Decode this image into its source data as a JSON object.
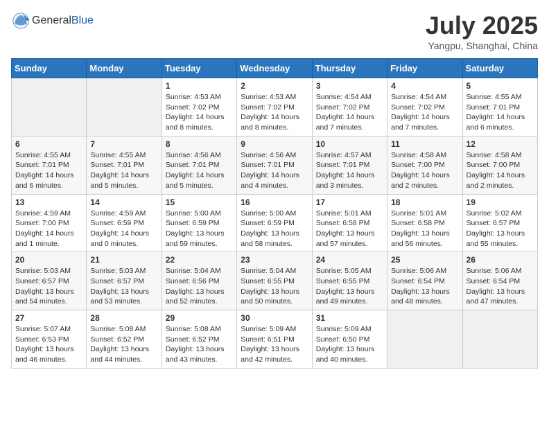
{
  "header": {
    "logo_general": "General",
    "logo_blue": "Blue",
    "month_title": "July 2025",
    "location": "Yangpu, Shanghai, China"
  },
  "weekdays": [
    "Sunday",
    "Monday",
    "Tuesday",
    "Wednesday",
    "Thursday",
    "Friday",
    "Saturday"
  ],
  "weeks": [
    [
      {
        "day": "",
        "info": ""
      },
      {
        "day": "",
        "info": ""
      },
      {
        "day": "1",
        "sunrise": "4:53 AM",
        "sunset": "7:02 PM",
        "daylight": "14 hours and 8 minutes."
      },
      {
        "day": "2",
        "sunrise": "4:53 AM",
        "sunset": "7:02 PM",
        "daylight": "14 hours and 8 minutes."
      },
      {
        "day": "3",
        "sunrise": "4:54 AM",
        "sunset": "7:02 PM",
        "daylight": "14 hours and 7 minutes."
      },
      {
        "day": "4",
        "sunrise": "4:54 AM",
        "sunset": "7:02 PM",
        "daylight": "14 hours and 7 minutes."
      },
      {
        "day": "5",
        "sunrise": "4:55 AM",
        "sunset": "7:01 PM",
        "daylight": "14 hours and 6 minutes."
      }
    ],
    [
      {
        "day": "6",
        "sunrise": "4:55 AM",
        "sunset": "7:01 PM",
        "daylight": "14 hours and 6 minutes."
      },
      {
        "day": "7",
        "sunrise": "4:55 AM",
        "sunset": "7:01 PM",
        "daylight": "14 hours and 5 minutes."
      },
      {
        "day": "8",
        "sunrise": "4:56 AM",
        "sunset": "7:01 PM",
        "daylight": "14 hours and 5 minutes."
      },
      {
        "day": "9",
        "sunrise": "4:56 AM",
        "sunset": "7:01 PM",
        "daylight": "14 hours and 4 minutes."
      },
      {
        "day": "10",
        "sunrise": "4:57 AM",
        "sunset": "7:01 PM",
        "daylight": "14 hours and 3 minutes."
      },
      {
        "day": "11",
        "sunrise": "4:58 AM",
        "sunset": "7:00 PM",
        "daylight": "14 hours and 2 minutes."
      },
      {
        "day": "12",
        "sunrise": "4:58 AM",
        "sunset": "7:00 PM",
        "daylight": "14 hours and 2 minutes."
      }
    ],
    [
      {
        "day": "13",
        "sunrise": "4:59 AM",
        "sunset": "7:00 PM",
        "daylight": "14 hours and 1 minute."
      },
      {
        "day": "14",
        "sunrise": "4:59 AM",
        "sunset": "6:59 PM",
        "daylight": "14 hours and 0 minutes."
      },
      {
        "day": "15",
        "sunrise": "5:00 AM",
        "sunset": "6:59 PM",
        "daylight": "13 hours and 59 minutes."
      },
      {
        "day": "16",
        "sunrise": "5:00 AM",
        "sunset": "6:59 PM",
        "daylight": "13 hours and 58 minutes."
      },
      {
        "day": "17",
        "sunrise": "5:01 AM",
        "sunset": "6:58 PM",
        "daylight": "13 hours and 57 minutes."
      },
      {
        "day": "18",
        "sunrise": "5:01 AM",
        "sunset": "6:58 PM",
        "daylight": "13 hours and 56 minutes."
      },
      {
        "day": "19",
        "sunrise": "5:02 AM",
        "sunset": "6:57 PM",
        "daylight": "13 hours and 55 minutes."
      }
    ],
    [
      {
        "day": "20",
        "sunrise": "5:03 AM",
        "sunset": "6:57 PM",
        "daylight": "13 hours and 54 minutes."
      },
      {
        "day": "21",
        "sunrise": "5:03 AM",
        "sunset": "6:57 PM",
        "daylight": "13 hours and 53 minutes."
      },
      {
        "day": "22",
        "sunrise": "5:04 AM",
        "sunset": "6:56 PM",
        "daylight": "13 hours and 52 minutes."
      },
      {
        "day": "23",
        "sunrise": "5:04 AM",
        "sunset": "6:55 PM",
        "daylight": "13 hours and 50 minutes."
      },
      {
        "day": "24",
        "sunrise": "5:05 AM",
        "sunset": "6:55 PM",
        "daylight": "13 hours and 49 minutes."
      },
      {
        "day": "25",
        "sunrise": "5:06 AM",
        "sunset": "6:54 PM",
        "daylight": "13 hours and 48 minutes."
      },
      {
        "day": "26",
        "sunrise": "5:06 AM",
        "sunset": "6:54 PM",
        "daylight": "13 hours and 47 minutes."
      }
    ],
    [
      {
        "day": "27",
        "sunrise": "5:07 AM",
        "sunset": "6:53 PM",
        "daylight": "13 hours and 46 minutes."
      },
      {
        "day": "28",
        "sunrise": "5:08 AM",
        "sunset": "6:52 PM",
        "daylight": "13 hours and 44 minutes."
      },
      {
        "day": "29",
        "sunrise": "5:08 AM",
        "sunset": "6:52 PM",
        "daylight": "13 hours and 43 minutes."
      },
      {
        "day": "30",
        "sunrise": "5:09 AM",
        "sunset": "6:51 PM",
        "daylight": "13 hours and 42 minutes."
      },
      {
        "day": "31",
        "sunrise": "5:09 AM",
        "sunset": "6:50 PM",
        "daylight": "13 hours and 40 minutes."
      },
      {
        "day": "",
        "info": ""
      },
      {
        "day": "",
        "info": ""
      }
    ]
  ]
}
